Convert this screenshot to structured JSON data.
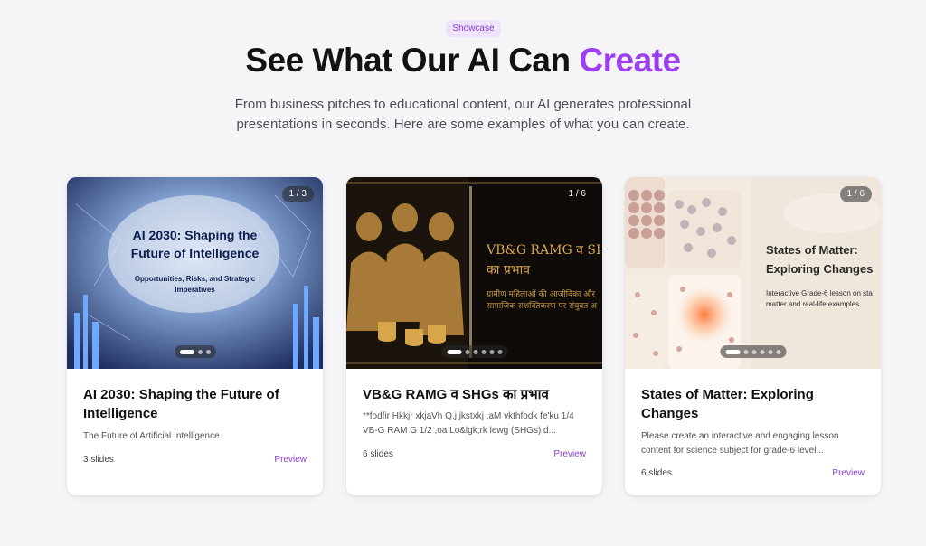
{
  "header": {
    "badge": "Showcase",
    "title_main": "See What Our AI Can ",
    "title_accent": "Create",
    "subtitle_line1": "From business pitches to educational content, our AI generates professional",
    "subtitle_line2": "presentations in seconds. Here are some examples of what you can create."
  },
  "cards": [
    {
      "counter": "1 / 3",
      "slide_title_line1": "AI 2030: Shaping the",
      "slide_title_line2": "Future of Intelligence",
      "slide_sub_line1": "Opportunities, Risks, and Strategic",
      "slide_sub_line2": "Imperatives",
      "title": "AI 2030: Shaping the Future of Intelligence",
      "description": "The Future of Artificial Intelligence",
      "slides": "3 slides",
      "preview": "Preview"
    },
    {
      "counter": "1 / 6",
      "slide_title_line1": "VB&G RAMG व SH",
      "slide_title_line2": "का प्रभाव",
      "slide_sub_line1": "ग्रामीण महिलाओं की आजीविका और",
      "slide_sub_line2": "सामाजिक सशक्तिकरण पर संयुक्त अ",
      "title": "VB&G RAMG व SHGs का प्रभाव",
      "description": "**fodfir Hkkjr xkjaVh Q,j jkstxkj ,aM vkthfodk fe'ku 1/4 VB-G RAM G 1/2 ,oa Lo&lgk;rk lewg (SHGs) d...",
      "slides": "6 slides",
      "preview": "Preview"
    },
    {
      "counter": "1 / 6",
      "slide_title_line1": "States of Matter:",
      "slide_title_line2": "Exploring Changes",
      "slide_sub_line1": "Interactive Grade-6 lesson on sta",
      "slide_sub_line2": "matter and real-life examples",
      "title": "States of Matter: Exploring Changes",
      "description": "Please create an interactive and engaging lesson content for science subject for grade-6 level...",
      "slides": "6 slides",
      "preview": "Preview"
    }
  ]
}
